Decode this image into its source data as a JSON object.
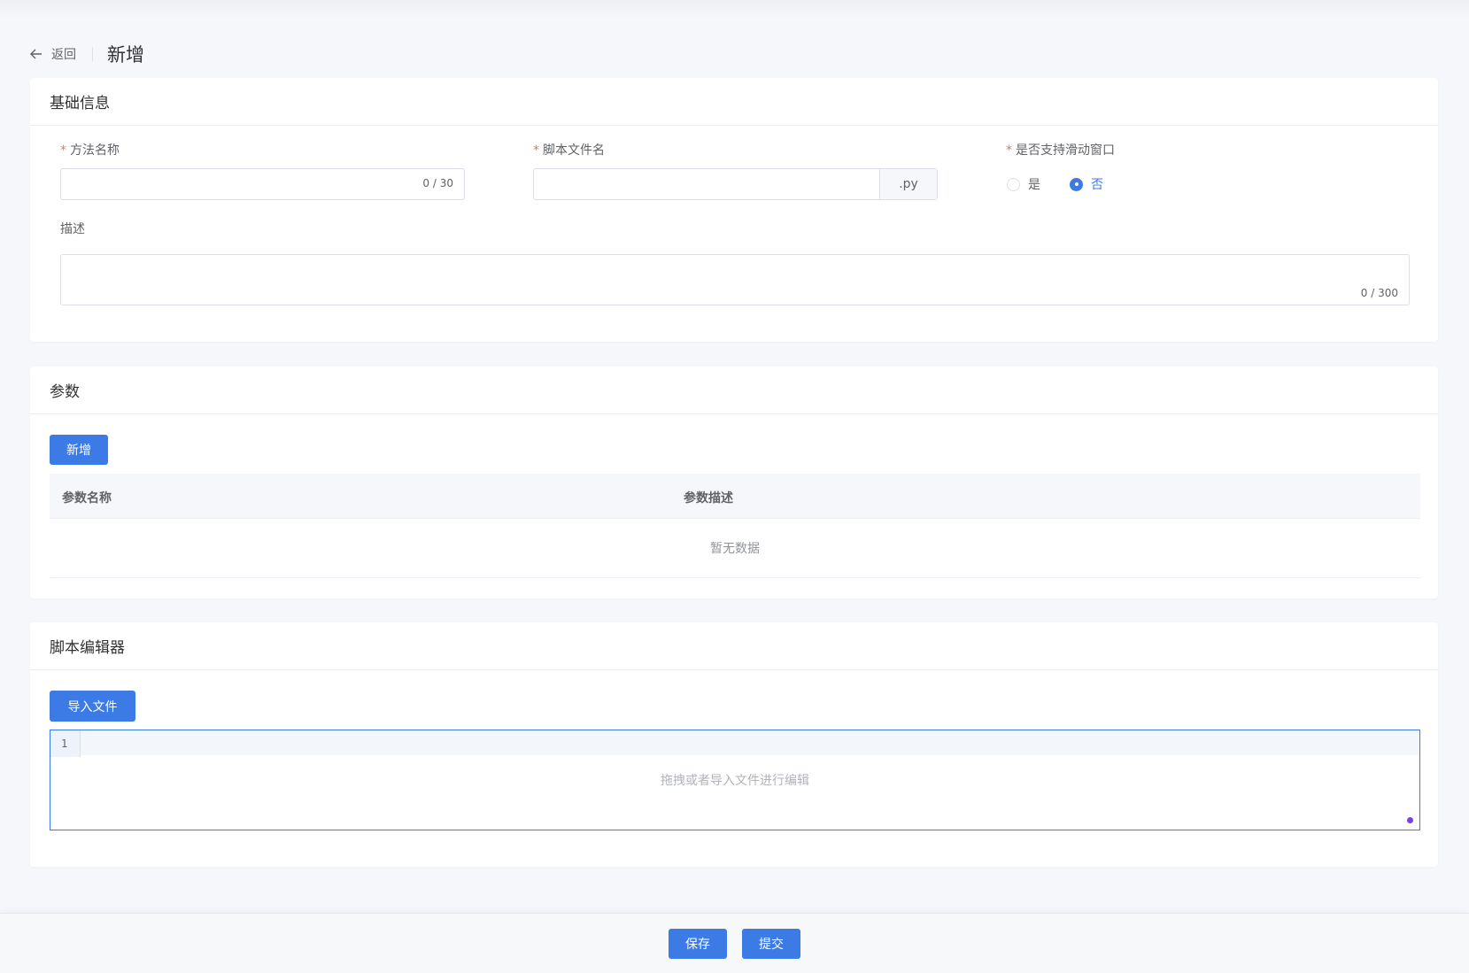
{
  "header": {
    "back_label": "返回",
    "title": "新增"
  },
  "basic": {
    "title": "基础信息",
    "method_name": {
      "label": "方法名称",
      "value": "",
      "count": "0 / 30"
    },
    "script_file": {
      "label": "脚本文件名",
      "value": "",
      "suffix": ".py"
    },
    "sliding_window": {
      "label": "是否支持滑动窗口",
      "options": [
        "是",
        "否"
      ],
      "selected": "否"
    },
    "description": {
      "label": "描述",
      "value": "",
      "count": "0 / 300"
    }
  },
  "params": {
    "title": "参数",
    "add_label": "新增",
    "columns": [
      "参数名称",
      "参数描述"
    ],
    "empty_text": "暂无数据"
  },
  "editor": {
    "title": "脚本编辑器",
    "import_label": "导入文件",
    "line_number": "1",
    "placeholder": "拖拽或者导入文件进行编辑"
  },
  "footer": {
    "save_label": "保存",
    "submit_label": "提交"
  },
  "colors": {
    "primary": "#3c7be6",
    "required": "#f56c6c",
    "background": "#f5f7fa"
  },
  "icons": {
    "back": "arrow-left-icon"
  }
}
